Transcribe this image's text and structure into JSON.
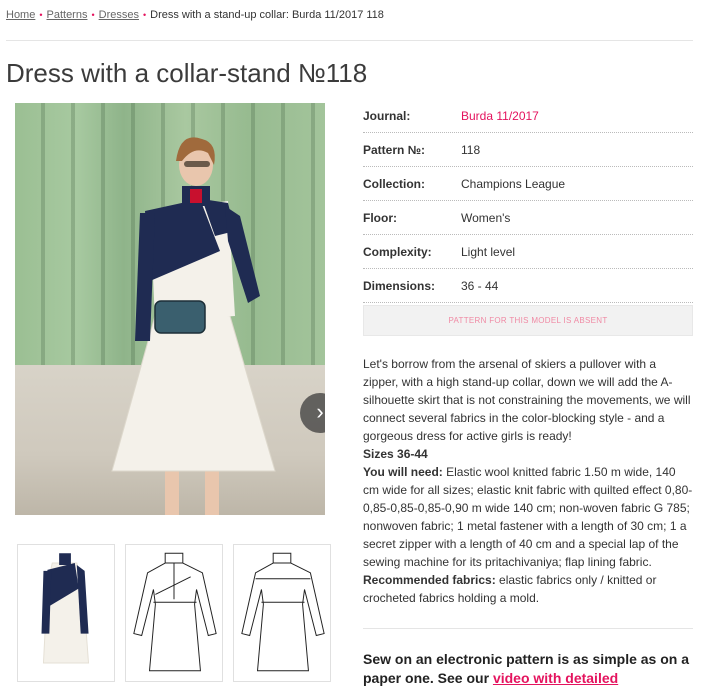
{
  "breadcrumb": {
    "items": [
      "Home",
      "Patterns",
      "Dresses"
    ],
    "current": "Dress with a stand-up collar: Burda 11/2017 118"
  },
  "page": {
    "title": "Dress with a collar-stand №118"
  },
  "specs": [
    {
      "key": "Journal:",
      "value": "Burda 11/2017"
    },
    {
      "key": "Pattern №:",
      "value": "118"
    },
    {
      "key": "Collection:",
      "value": "Champions League"
    },
    {
      "key": "Floor:",
      "value": "Women's"
    },
    {
      "key": "Complexity:",
      "value": "Light level"
    },
    {
      "key": "Dimensions:",
      "value": "36 - 44"
    }
  ],
  "absent_notice": "PATTERN FOR THIS MODEL IS ABSENT",
  "description": {
    "intro": "Let's borrow from the arsenal of skiers a pullover with a zipper, with a high stand-up collar, down we will add the A-silhouette skirt that is not constraining the movements, we will connect several fabrics in the color-blocking style - and a gorgeous dress for active girls is ready!",
    "sizes": "Sizes 36-44",
    "need_label": "You will need:",
    "need_text": " Elastic wool knitted fabric 1.50 m wide, 140 cm wide for all sizes; elastic knit fabric with quilted effect 0,80-0,85-0,85-0,85-0,90 m wide 140 cm; non-woven fabric G 785; nonwoven fabric; 1 metal fastener with a length of 30 cm; 1 a secret zipper with a length of 40 cm and a special lap of the sewing machine for its pritachivaniya; flap lining fabric.",
    "rec_label": "Recommended fabrics:",
    "rec_text": " elastic fabrics only / knitted or crocheted fabrics holding a mold."
  },
  "promo": {
    "text": "Sew on an electronic pattern is as simple as on a paper one. See our ",
    "link": "video with detailed instructions"
  },
  "gallery": {
    "next_icon": "chevron-right-icon",
    "thumbnails": [
      "photo-thumbnail",
      "front-sketch-thumbnail",
      "back-sketch-thumbnail"
    ]
  },
  "colors": {
    "accent": "#e4135e",
    "navy": "#1f2b52",
    "cream": "#f4f1ea"
  }
}
